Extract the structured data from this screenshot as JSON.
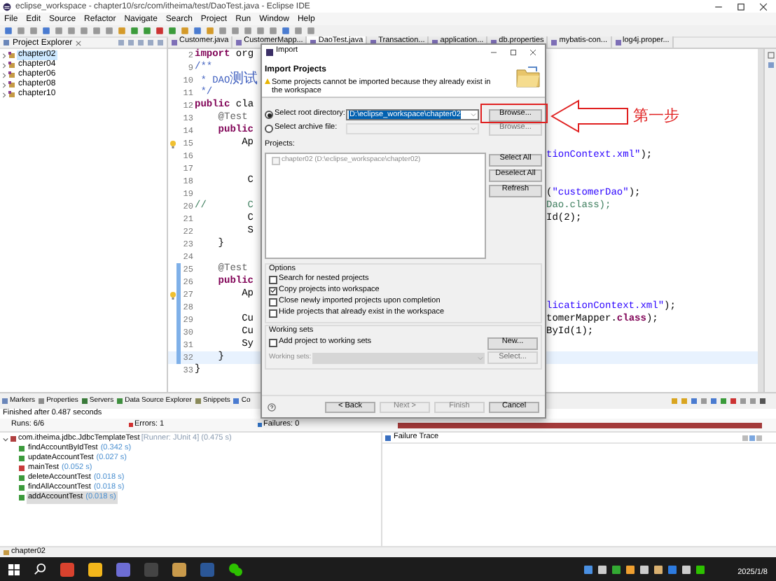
{
  "window": {
    "title": "eclipse_workspace - chapter10/src/com/itheima/test/DaoTest.java - Eclipse IDE"
  },
  "menu": [
    "File",
    "Edit",
    "Source",
    "Refactor",
    "Navigate",
    "Search",
    "Project",
    "Run",
    "Window",
    "Help"
  ],
  "project_explorer": {
    "title": "Project Explorer",
    "items": [
      {
        "label": "chapter02",
        "selected": true
      },
      {
        "label": "chapter04",
        "selected": false
      },
      {
        "label": "chapter06",
        "selected": false
      },
      {
        "label": "chapter08",
        "selected": false
      },
      {
        "label": "chapter10",
        "selected": false
      }
    ]
  },
  "editor": {
    "tabs": [
      {
        "label": "Customer.java",
        "selected": false
      },
      {
        "label": "CustomerMapp...",
        "selected": false
      },
      {
        "label": "DaoTest.java",
        "selected": true
      },
      {
        "label": "Transaction...",
        "selected": false
      },
      {
        "label": "application...",
        "selected": false
      },
      {
        "label": "db.properties",
        "selected": false
      },
      {
        "label": "mybatis-con...",
        "selected": false
      },
      {
        "label": "log4j.proper...",
        "selected": false
      }
    ],
    "lines": [
      {
        "number": "2",
        "warning": false,
        "changed": false,
        "current": false,
        "left": [
          {
            "kind": "keyword",
            "text": "import"
          },
          {
            "kind": "plain",
            "text": " org"
          }
        ]
      },
      {
        "number": "9",
        "warning": false,
        "changed": false,
        "current": false,
        "left": [
          {
            "kind": "javadoc",
            "text": "/**"
          }
        ]
      },
      {
        "number": "10",
        "warning": false,
        "changed": false,
        "current": false,
        "left": [
          {
            "kind": "javadoc",
            "text": " * DAO"
          },
          {
            "kind": "javadoc_cjk",
            "text": "测试"
          }
        ]
      },
      {
        "number": "11",
        "warning": false,
        "changed": false,
        "current": false,
        "left": [
          {
            "kind": "javadoc",
            "text": " */"
          }
        ]
      },
      {
        "number": "12",
        "warning": false,
        "changed": false,
        "current": false,
        "left": [
          {
            "kind": "keyword",
            "text": "public"
          },
          {
            "kind": "plain",
            "text": " cla"
          }
        ]
      },
      {
        "number": "13",
        "warning": false,
        "changed": false,
        "current": false,
        "left": [
          {
            "kind": "annotation",
            "text": "    @Test"
          }
        ]
      },
      {
        "number": "14",
        "warning": false,
        "changed": false,
        "current": false,
        "left": [
          {
            "kind": "keyword",
            "text": "    public"
          }
        ]
      },
      {
        "number": "15",
        "warning": true,
        "changed": false,
        "current": false,
        "left": [
          {
            "kind": "plain",
            "text": "        Ap"
          }
        ]
      },
      {
        "number": "16",
        "warning": false,
        "changed": false,
        "current": false,
        "right": [
          {
            "kind": "string",
            "text": "tionContext.xml\""
          },
          {
            "kind": "plain",
            "text": ");"
          }
        ]
      },
      {
        "number": "17",
        "warning": false,
        "changed": false,
        "current": false
      },
      {
        "number": "18",
        "warning": false,
        "changed": false,
        "current": false,
        "left": [
          {
            "kind": "plain",
            "text": "         C"
          }
        ]
      },
      {
        "number": "19",
        "warning": false,
        "changed": false,
        "current": false,
        "right": [
          {
            "kind": "plain",
            "text": "("
          },
          {
            "kind": "string",
            "text": "\"customerDao\""
          },
          {
            "kind": "plain",
            "text": ");"
          }
        ]
      },
      {
        "number": "20",
        "warning": false,
        "changed": false,
        "current": false,
        "left": [
          {
            "kind": "comment",
            "text": "//       C"
          }
        ],
        "right": [
          {
            "kind": "comment",
            "text": "Dao.class);"
          }
        ]
      },
      {
        "number": "21",
        "warning": false,
        "changed": false,
        "current": false,
        "left": [
          {
            "kind": "plain",
            "text": "         C"
          }
        ],
        "right": [
          {
            "kind": "plain",
            "text": "Id(2);"
          }
        ]
      },
      {
        "number": "22",
        "warning": false,
        "changed": false,
        "current": false,
        "left": [
          {
            "kind": "plain",
            "text": "         S"
          }
        ]
      },
      {
        "number": "23",
        "warning": false,
        "changed": false,
        "current": false,
        "left": [
          {
            "kind": "plain",
            "text": "    }"
          }
        ]
      },
      {
        "number": "24",
        "warning": false,
        "changed": false,
        "current": false
      },
      {
        "number": "25",
        "warning": false,
        "changed": true,
        "current": false,
        "left": [
          {
            "kind": "annotation",
            "text": "    @Test"
          }
        ]
      },
      {
        "number": "26",
        "warning": false,
        "changed": true,
        "current": false,
        "left": [
          {
            "kind": "keyword",
            "text": "    public"
          }
        ]
      },
      {
        "number": "27",
        "warning": true,
        "changed": true,
        "current": false,
        "left": [
          {
            "kind": "plain",
            "text": "        Ap"
          }
        ]
      },
      {
        "number": "28",
        "warning": false,
        "changed": true,
        "current": false,
        "right": [
          {
            "kind": "string",
            "text": "licationContext.xml\""
          },
          {
            "kind": "plain",
            "text": ");"
          }
        ]
      },
      {
        "number": "29",
        "warning": false,
        "changed": true,
        "current": false,
        "left": [
          {
            "kind": "plain",
            "text": "        Cu"
          }
        ],
        "right": [
          {
            "kind": "plain",
            "text": "tomerMapper."
          },
          {
            "kind": "keyword",
            "text": "class"
          },
          {
            "kind": "plain",
            "text": ");"
          }
        ]
      },
      {
        "number": "30",
        "warning": false,
        "changed": true,
        "current": false,
        "left": [
          {
            "kind": "plain",
            "text": "        Cu"
          }
        ],
        "right": [
          {
            "kind": "plain",
            "text": "ById(1);"
          }
        ]
      },
      {
        "number": "31",
        "warning": false,
        "changed": true,
        "current": false,
        "left": [
          {
            "kind": "plain",
            "text": "        Sy"
          }
        ]
      },
      {
        "number": "32",
        "warning": false,
        "changed": true,
        "current": true,
        "left": [
          {
            "kind": "plain",
            "text": "    }"
          }
        ]
      },
      {
        "number": "33",
        "warning": false,
        "changed": false,
        "current": false,
        "left": [
          {
            "kind": "plain",
            "text": "}"
          }
        ]
      }
    ]
  },
  "dialog": {
    "title": "Import",
    "heading": "Import Projects",
    "warning": "Some projects cannot be imported because they already exist in the workspace",
    "sources": [
      {
        "label": "Select root directory:",
        "selected": true,
        "value": "D:\\eclipse_workspace\\chapter02",
        "button": "Browse...",
        "disabled": false
      },
      {
        "label": "Select archive file:",
        "selected": false,
        "button": "Browse...",
        "disabled": true
      }
    ],
    "projects_label": "Projects:",
    "projects": [
      {
        "label": "chapter02 (D:\\eclipse_workspace\\chapter02)",
        "checked": false,
        "disabled": true
      }
    ],
    "list_buttons": [
      "Select All",
      "Deselect All",
      "Refresh"
    ],
    "options": {
      "title": "Options",
      "items": [
        {
          "label": "Search for nested projects",
          "checked": false
        },
        {
          "label": "Copy projects into workspace",
          "checked": true
        },
        {
          "label": "Close newly imported projects upon completion",
          "checked": false
        },
        {
          "label": "Hide projects that already exist in the workspace",
          "checked": false
        }
      ]
    },
    "working_sets": {
      "title": "Working sets",
      "checkbox": {
        "label": "Add project to working sets",
        "checked": false
      },
      "new_button": "New...",
      "field_label": "Working sets:",
      "select_button": "Select..."
    },
    "buttons": [
      {
        "label": "< Back",
        "disabled": false
      },
      {
        "label": "Next >",
        "disabled": true
      },
      {
        "label": "Finish",
        "disabled": true
      },
      {
        "label": "Cancel",
        "disabled": false
      }
    ]
  },
  "annotation": {
    "text": "第一步"
  },
  "bottom_panel": {
    "tabs": [
      "Markers",
      "Properties",
      "Servers",
      "Data Source Explorer",
      "Snippets",
      "Co"
    ],
    "status": "Finished after 0.487 seconds",
    "runs": "Runs: 6/6",
    "errors": "Errors: 1",
    "failures": "Failures: 0",
    "progress": {
      "level": 1,
      "failed": true
    },
    "tests": {
      "label": "com.itheima.jdbc.JdbcTemplateTest",
      "detail": "[Runner: JUnit 4] (0.475 s)",
      "expanded": true,
      "children": [
        {
          "label": "findAccountByIdTest",
          "time": "(0.342 s)",
          "error": false,
          "selected": false
        },
        {
          "label": "updateAccountTest",
          "time": "(0.027 s)",
          "error": false,
          "selected": false
        },
        {
          "label": "mainTest",
          "time": "(0.052 s)",
          "error": true,
          "selected": false
        },
        {
          "label": "deleteAccountTest",
          "time": "(0.018 s)",
          "error": false,
          "selected": false
        },
        {
          "label": "findAllAccountTest",
          "time": "(0.018 s)",
          "error": false,
          "selected": false
        },
        {
          "label": "addAccountTest",
          "time": "(0.018 s)",
          "error": false,
          "selected": true
        }
      ]
    },
    "failure_trace": {
      "title": "Failure Trace"
    }
  },
  "status_bar": {
    "text": "chapter02"
  },
  "taskbar": {
    "date": "2025/1/8"
  }
}
